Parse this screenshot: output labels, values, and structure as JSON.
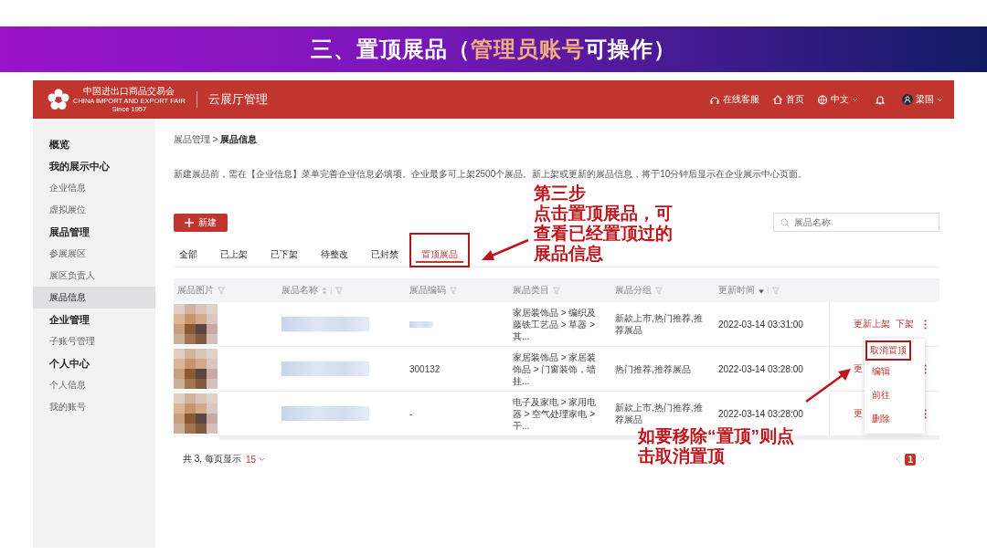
{
  "slide": {
    "title_parts": [
      {
        "text": "三、置顶展品（",
        "highlight": false
      },
      {
        "text": "管理员账号",
        "highlight": true
      },
      {
        "text": "可操作）",
        "highlight": false
      }
    ]
  },
  "header": {
    "logo_cn": "中国进出口商品交易会",
    "logo_en": "CHINA IMPORT AND EXPORT FAIR",
    "logo_since": "Since 1957",
    "app_title": "云展厅管理",
    "nav": [
      {
        "kind": "support",
        "label": "在线客服"
      },
      {
        "kind": "home",
        "label": "首页"
      },
      {
        "kind": "language",
        "label": "中文"
      },
      {
        "kind": "bell"
      },
      {
        "kind": "user",
        "label": "梁国"
      }
    ]
  },
  "sidebar": {
    "items": [
      {
        "kind": "section",
        "label": "概览",
        "selected": false
      },
      {
        "kind": "section",
        "label": "我的展示中心",
        "selected": false
      },
      {
        "kind": "item",
        "label": "企业信息",
        "selected": false
      },
      {
        "kind": "item",
        "label": "虚拟展位",
        "selected": false
      },
      {
        "kind": "section",
        "label": "展品管理",
        "selected": false
      },
      {
        "kind": "item",
        "label": "参展展区",
        "selected": false
      },
      {
        "kind": "item",
        "label": "展区负责人",
        "selected": false
      },
      {
        "kind": "item",
        "label": "展品信息",
        "selected": true
      },
      {
        "kind": "section",
        "label": "企业管理",
        "selected": false
      },
      {
        "kind": "item",
        "label": "子账号管理",
        "selected": false
      },
      {
        "kind": "section",
        "label": "个人中心",
        "selected": false
      },
      {
        "kind": "item",
        "label": "个人信息",
        "selected": false
      },
      {
        "kind": "item",
        "label": "我的账号",
        "selected": false
      }
    ]
  },
  "breadcrumb": "展品管理 > **展品信息**",
  "notice": "新建展品前，需在【企业信息】菜单完善企业信息必填项。企业最多可上架2500个展品。新上架或更新的展品信息，将于10分钟后显示在企业展示中心页面。",
  "new_button": {
    "label": "新建"
  },
  "search": {
    "placeholder": "展品名称"
  },
  "tabs": [
    {
      "label": "全部",
      "selected": false,
      "annotated": false
    },
    {
      "label": "已上架",
      "selected": false,
      "annotated": false
    },
    {
      "label": "已下架",
      "selected": false,
      "annotated": false
    },
    {
      "label": "待整改",
      "selected": false,
      "annotated": false
    },
    {
      "label": "已封禁",
      "selected": false,
      "annotated": false
    },
    {
      "label": "置顶展品",
      "selected": true,
      "annotated": true
    }
  ],
  "table": {
    "columns": [
      {
        "label": "展品图片",
        "sortable": false,
        "sorted_desc": false
      },
      {
        "label": "展品名称",
        "sortable": true,
        "sorted_desc": false
      },
      {
        "label": "展品编码",
        "sortable": false,
        "sorted_desc": false
      },
      {
        "label": "展品类目",
        "sortable": false,
        "sorted_desc": false
      },
      {
        "label": "展品分组",
        "sortable": false,
        "sorted_desc": false
      },
      {
        "label": "更新时间",
        "sortable": false,
        "sorted_desc": true
      }
    ],
    "rows": [
      {
        "name_blurred": true,
        "code_blurred": true,
        "category": "家居装饰品 > 编织及藤铁工艺品 > 草器 > 其...",
        "group": "新款上市,热门推荐,推荐展品",
        "time": "2022-03-14 03:31:00",
        "actions": [
          "更新上架",
          "下架"
        ]
      },
      {
        "name_blurred": true,
        "code_blurred": false,
        "code": "300132",
        "category": "家居装饰品 > 家居装饰品 > 门窗装饰，墙挂...",
        "group": "热门推荐,推荐展品",
        "time": "2022-03-14 03:28:00",
        "actions": [
          "更"
        ]
      },
      {
        "name_blurred": true,
        "code_blurred": false,
        "code": "-",
        "category": "电子及家电 > 家用电器 > 空气处理家电 > 干...",
        "group": "新款上市,热门推荐,推荐展品",
        "time": "2022-03-14 03:28:00",
        "actions": [
          "更"
        ]
      }
    ]
  },
  "row_menu": {
    "items": [
      {
        "label": "取消置顶",
        "annotated": true
      },
      {
        "label": "编辑",
        "annotated": false
      },
      {
        "label": "前往",
        "annotated": false
      },
      {
        "label": "删除",
        "annotated": false
      }
    ]
  },
  "footer": {
    "total": "共 3, 每页显示",
    "page_size": "15",
    "current_page": "1"
  },
  "annotations": {
    "step_note": [
      "第三步",
      "点击置顶展品，可",
      "查看已经置顶过的",
      "展品信息"
    ],
    "remove_note": [
      "如要移除“置顶”则点",
      "击取消置顶"
    ]
  }
}
